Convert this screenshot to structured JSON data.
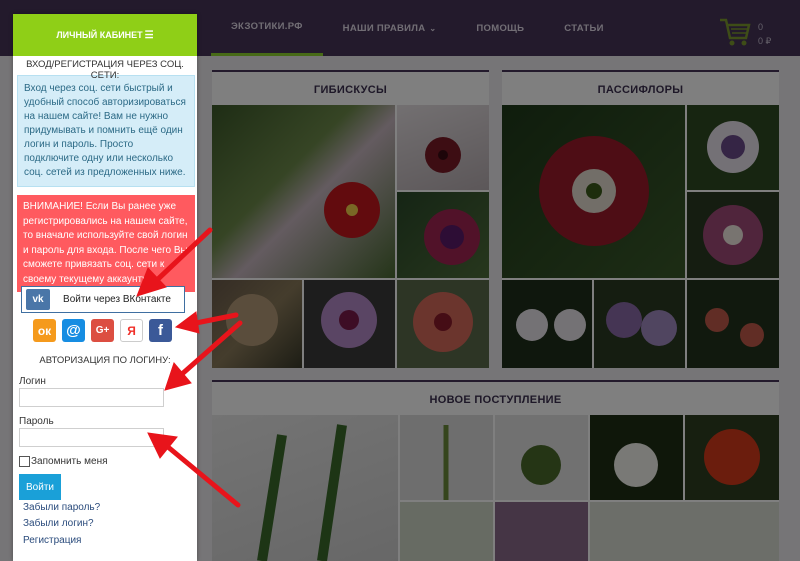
{
  "nav": {
    "items": [
      {
        "label": "ЭКЗОТИКИ.РФ",
        "active": true
      },
      {
        "label": "НАШИ ПРАВИЛА",
        "dropdown": true
      },
      {
        "label": "ПОМОЩЬ"
      },
      {
        "label": "СТАТЬИ"
      }
    ]
  },
  "cart": {
    "count": "0",
    "sum": "0 ₽",
    "icon": "cart-icon"
  },
  "sidebar": {
    "header": "ЛИЧНЫЙ КАБИНЕТ",
    "social_title": "ВХОД/РЕГИСТРАЦИЯ ЧЕРЕЗ СОЦ. СЕТИ:",
    "info": "Вход через соц. сети быстрый и удобный способ авторизироваться на нашем сайте! Вам не нужно придумывать и помнить ещё один логин и пароль. Просто подключите одну или несколько соц. сетей из предложенных ниже.",
    "warning": "ВНИМАНИЕ! Если Вы ранее уже регистрировались на нашем сайте, то вначале используйте свой логин и пароль для входа. После чего Вы сможете привязать соц. сети к своему текущему аккаунту!",
    "vk_button": "Войти через ВКонтакте",
    "socials": [
      {
        "icon": "odnoklassniki-icon",
        "glyph": "ок"
      },
      {
        "icon": "mailru-icon",
        "glyph": "@"
      },
      {
        "icon": "googleplus-icon",
        "glyph": "G+"
      },
      {
        "icon": "yandex-icon",
        "glyph": "Я"
      },
      {
        "icon": "facebook-icon",
        "glyph": "f"
      }
    ],
    "login_title": "АВТОРИЗАЦИЯ ПО ЛОГИНУ:",
    "login_label": "Логин",
    "password_label": "Пароль",
    "login_value": "",
    "password_value": "",
    "remember_label": "Запомнить меня",
    "submit": "Войти",
    "links": [
      "Забыли пароль?",
      "Забыли логин?",
      "Регистрация"
    ]
  },
  "panels": {
    "hibiscus": "ГИБИСКУСЫ",
    "passiflora": "ПАССИФЛОРЫ",
    "new": "НОВОЕ ПОСТУПЛЕНИЕ"
  },
  "colors": {
    "topbar": "#463459",
    "accent": "#8fd52e",
    "warning": "#ff5a5f",
    "info_bg": "#d5edf8",
    "arrow": "#e8141b"
  }
}
